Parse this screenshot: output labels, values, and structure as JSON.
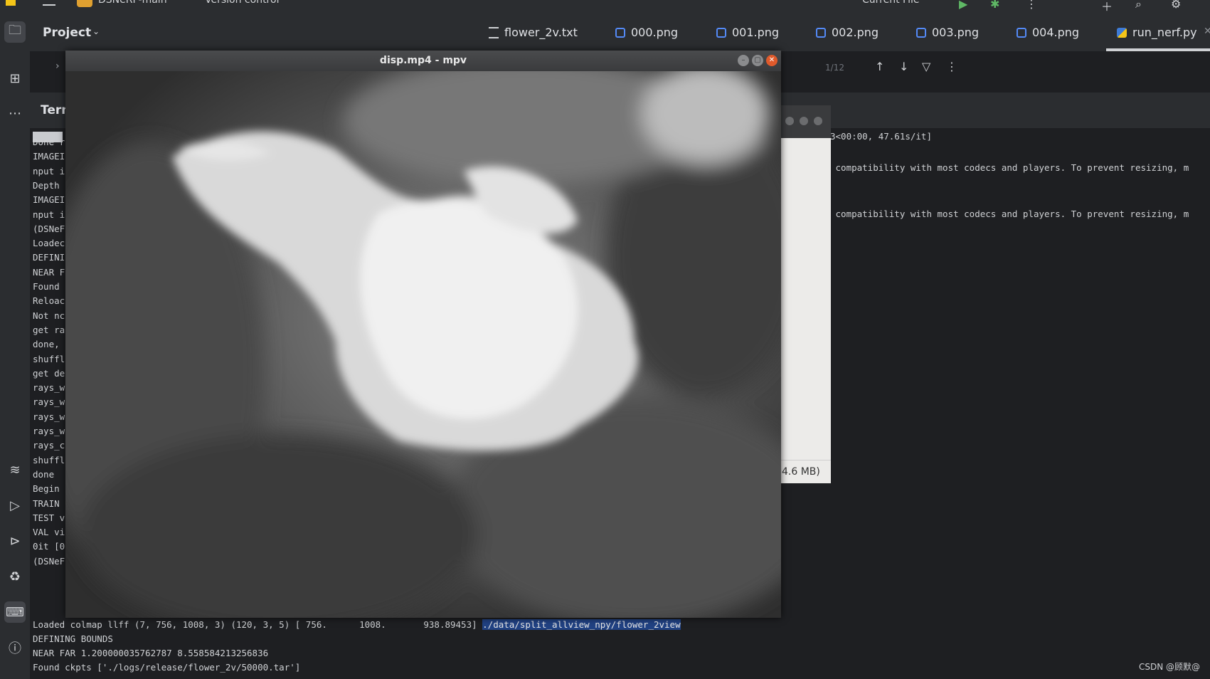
{
  "topbar": {
    "project_name": "DSNeRF-main",
    "vcs_label": "Version control",
    "run_config": "Current File"
  },
  "project_panel": {
    "title": "Project"
  },
  "tabs": [
    {
      "label": "flower_2v.txt",
      "icon": "text-file-icon"
    },
    {
      "label": "000.png",
      "icon": "image-file-icon"
    },
    {
      "label": "001.png",
      "icon": "image-file-icon"
    },
    {
      "label": "002.png",
      "icon": "image-file-icon"
    },
    {
      "label": "003.png",
      "icon": "image-file-icon"
    },
    {
      "label": "004.png",
      "icon": "image-file-icon"
    },
    {
      "label": "run_nerf.py",
      "icon": "python-file-icon"
    }
  ],
  "editor": {
    "page_indicator": "1/12"
  },
  "terminal": {
    "header": "Terminal",
    "lines_left": [
      "Done r",
      "IMAGEI",
      "nput i",
      "Depth",
      "IMAGEI",
      "nput i",
      "(DSNeF",
      "Loadec",
      "DEFINI",
      "NEAR F",
      "Found",
      "Reloac",
      "Not nc",
      "get ra",
      "done,",
      "shuffl",
      "get de",
      "rays_w",
      "rays_w",
      "rays_w",
      "rays_w",
      "rays_c",
      "shuffl",
      "done",
      "Begin",
      "TRAIN",
      "TEST v",
      "VAL vi",
      "0it [0",
      "(DSNeF"
    ],
    "right_line_1": "3<00:00, 47.61s/it]",
    "right_line_2": " compatibility with most codecs and players. To prevent resizing, m",
    "right_line_3": " compatibility with most codecs and players. To prevent resizing, m",
    "loaded_line_prefix": "Loaded colmap llff (7, 756, 1008, 3) (120, 3, 5) [ 756.      1008.       938.89453] ",
    "loaded_line_path": "./data/split_allview_npy/flower_2view",
    "bounds_line": "DEFINING BOUNDS",
    "nearfar_line": "NEAR FAR 1.200000035762787 8.558584213256836",
    "ckpt_line": "Found ckpts ['./logs/release/flower_2v/50000.tar']"
  },
  "background_window": {
    "footer_text": "4.6 MB)"
  },
  "mpv_window": {
    "title": "disp.mp4 - mpv"
  },
  "watermark": "CSDN @顾默@",
  "colors": {
    "ide_bg": "#1e1f22",
    "panel_bg": "#2b2d30",
    "selection": "#214283",
    "mpv_close": "#e05a2b"
  }
}
